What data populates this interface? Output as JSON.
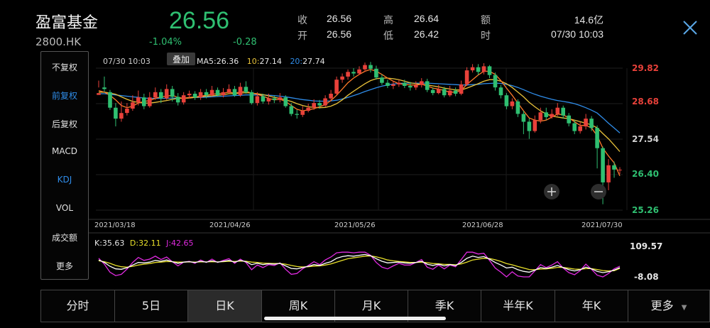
{
  "header": {
    "name": "盈富基金",
    "code": "2800.HK",
    "price": "26.56",
    "change_pct": "-1.04%",
    "change": "-0.28",
    "quote": [
      {
        "label": "收",
        "value": "26.56"
      },
      {
        "label": "开",
        "value": "26.56"
      },
      {
        "label": "高",
        "value": "26.64"
      },
      {
        "label": "低",
        "value": "26.42"
      },
      {
        "label": "额",
        "value": "14.6亿"
      },
      {
        "label": "时",
        "value": "07/30 10:03"
      }
    ],
    "close_icon": "close-icon"
  },
  "sidebar": {
    "items": [
      {
        "label": "不复权",
        "active": false
      },
      {
        "label": "前复权",
        "active": true
      },
      {
        "label": "后复权",
        "active": false
      },
      {
        "label": "MACD",
        "active": false
      },
      {
        "label": "KDJ",
        "active": true
      },
      {
        "label": "VOL",
        "active": false
      },
      {
        "label": "成交额",
        "active": false
      },
      {
        "label": "更多",
        "active": false
      }
    ]
  },
  "chart_info": {
    "time": "07/30 10:03",
    "overlay_label": "叠加",
    "ma5_label": "MA5:",
    "ma5_value": "26.36",
    "ma10_label": "10:",
    "ma10_value": "27.14",
    "ma20_label": "20:",
    "ma20_value": "27.74",
    "price_ticks": [
      "29.82",
      "28.68",
      "27.54",
      "26.40",
      "25.26"
    ],
    "date_ticks": [
      "2021/03/18",
      "2021/04/26",
      "2021/05/26",
      "2021/06/28",
      "2021/07/30"
    ],
    "kdj_k_label": "K:35.63",
    "kdj_d_label": "D:32.11",
    "kdj_j_label": "J:42.65",
    "kdj_max": "109.57",
    "kdj_min": "-8.08",
    "zoom_in_icon": "plus-icon",
    "zoom_out_icon": "minus-icon"
  },
  "colors": {
    "up": "#e8413a",
    "down": "#2fbf71",
    "ma5": "#ff7a2a",
    "ma10": "#e8c23a",
    "ma20": "#2f8ce8",
    "k": "#ffffff",
    "d": "#e8e02a",
    "j": "#e02ae0"
  },
  "chart_data": {
    "type": "candlestick",
    "ylim": [
      25.26,
      29.82
    ],
    "x_labels": [
      "2021/03/18",
      "2021/04/26",
      "2021/05/26",
      "2021/06/28",
      "2021/07/30"
    ],
    "candles": [
      [
        28.96,
        29.02,
        29.42,
        29.2
      ],
      [
        29.2,
        29.15,
        29.55,
        29.05
      ],
      [
        29.05,
        28.55,
        29.12,
        28.48
      ],
      [
        28.55,
        28.2,
        28.7,
        27.95
      ],
      [
        28.2,
        28.38,
        28.75,
        28.1
      ],
      [
        28.38,
        28.52,
        28.7,
        28.3
      ],
      [
        28.52,
        28.72,
        28.95,
        28.45
      ],
      [
        28.72,
        28.88,
        29.1,
        28.62
      ],
      [
        28.88,
        28.6,
        29.0,
        28.5
      ],
      [
        28.6,
        28.88,
        29.05,
        28.55
      ],
      [
        28.88,
        29.05,
        29.2,
        28.8
      ],
      [
        29.05,
        28.85,
        29.15,
        28.7
      ],
      [
        28.85,
        29.15,
        29.3,
        28.8
      ],
      [
        29.15,
        28.9,
        29.25,
        28.75
      ],
      [
        28.9,
        28.72,
        29.02,
        28.62
      ],
      [
        28.72,
        28.95,
        29.05,
        28.65
      ],
      [
        28.95,
        29.0,
        29.1,
        28.85
      ],
      [
        29.0,
        28.88,
        29.08,
        28.8
      ],
      [
        28.88,
        29.05,
        29.15,
        28.8
      ],
      [
        29.05,
        28.95,
        29.15,
        28.85
      ],
      [
        28.95,
        29.12,
        29.25,
        28.9
      ],
      [
        29.12,
        28.95,
        29.2,
        28.9
      ],
      [
        28.95,
        29.05,
        29.18,
        28.88
      ],
      [
        29.05,
        29.15,
        29.3,
        29.0
      ],
      [
        29.15,
        28.95,
        29.25,
        28.9
      ],
      [
        28.95,
        29.22,
        29.35,
        28.9
      ],
      [
        29.22,
        29.05,
        29.4,
        29.0
      ],
      [
        29.05,
        28.7,
        29.12,
        28.65
      ],
      [
        28.7,
        28.92,
        29.05,
        28.62
      ],
      [
        28.92,
        28.75,
        29.0,
        28.68
      ],
      [
        28.75,
        28.85,
        29.0,
        28.65
      ],
      [
        28.85,
        28.8,
        28.95,
        28.7
      ],
      [
        28.8,
        28.88,
        29.02,
        28.72
      ],
      [
        28.88,
        28.6,
        28.95,
        28.55
      ],
      [
        28.6,
        28.35,
        28.7,
        28.28
      ],
      [
        28.35,
        28.32,
        28.48,
        28.2
      ],
      [
        28.32,
        28.45,
        28.6,
        28.25
      ],
      [
        28.45,
        28.55,
        28.68,
        28.4
      ],
      [
        28.55,
        28.7,
        28.82,
        28.48
      ],
      [
        28.7,
        28.62,
        28.8,
        28.52
      ],
      [
        28.62,
        28.85,
        28.95,
        28.58
      ],
      [
        28.85,
        29.0,
        29.12,
        28.8
      ],
      [
        29.0,
        29.45,
        29.55,
        28.95
      ],
      [
        29.45,
        29.55,
        29.65,
        29.35
      ],
      [
        29.55,
        29.7,
        29.78,
        29.45
      ],
      [
        29.7,
        29.65,
        29.82,
        29.55
      ],
      [
        29.65,
        29.78,
        29.88,
        29.6
      ],
      [
        29.78,
        29.92,
        30.0,
        29.7
      ],
      [
        29.92,
        29.8,
        30.02,
        29.68
      ],
      [
        29.8,
        29.52,
        29.9,
        29.45
      ],
      [
        29.52,
        29.35,
        29.62,
        29.28
      ],
      [
        29.35,
        29.25,
        29.45,
        29.18
      ],
      [
        29.25,
        29.3,
        29.42,
        29.15
      ],
      [
        29.3,
        29.35,
        29.45,
        29.22
      ],
      [
        29.35,
        29.25,
        29.45,
        29.18
      ],
      [
        29.25,
        29.2,
        29.38,
        29.1
      ],
      [
        29.2,
        29.28,
        29.4,
        29.12
      ],
      [
        29.28,
        29.4,
        29.5,
        29.2
      ],
      [
        29.4,
        29.12,
        29.48,
        29.05
      ],
      [
        29.12,
        29.02,
        29.2,
        28.95
      ],
      [
        29.02,
        29.15,
        29.28,
        28.98
      ],
      [
        29.15,
        28.95,
        29.22,
        28.88
      ],
      [
        28.95,
        29.1,
        29.25,
        28.9
      ],
      [
        29.1,
        29.0,
        29.2,
        28.92
      ],
      [
        29.0,
        29.3,
        29.42,
        28.95
      ],
      [
        29.3,
        29.75,
        29.85,
        29.25
      ],
      [
        29.75,
        29.85,
        29.95,
        29.68
      ],
      [
        29.85,
        29.7,
        29.95,
        29.6
      ],
      [
        29.7,
        29.88,
        29.98,
        29.62
      ],
      [
        29.88,
        29.6,
        29.92,
        29.5
      ],
      [
        29.6,
        29.2,
        29.68,
        29.1
      ],
      [
        29.2,
        28.95,
        29.28,
        28.85
      ],
      [
        28.95,
        28.6,
        29.02,
        28.5
      ],
      [
        28.6,
        28.75,
        28.85,
        28.5
      ],
      [
        28.75,
        28.35,
        28.82,
        28.25
      ],
      [
        28.35,
        28.1,
        28.45,
        27.7
      ],
      [
        28.1,
        27.8,
        28.2,
        27.55
      ],
      [
        27.8,
        28.15,
        28.3,
        27.75
      ],
      [
        28.15,
        28.4,
        28.55,
        28.05
      ],
      [
        28.4,
        28.25,
        28.55,
        28.15
      ],
      [
        28.25,
        28.35,
        28.5,
        28.2
      ],
      [
        28.35,
        28.55,
        28.7,
        28.28
      ],
      [
        28.55,
        28.3,
        28.62,
        28.2
      ],
      [
        28.3,
        28.05,
        28.38,
        27.95
      ],
      [
        28.05,
        27.8,
        28.15,
        27.7
      ],
      [
        27.8,
        27.95,
        28.1,
        27.72
      ],
      [
        27.95,
        28.2,
        28.35,
        27.85
      ],
      [
        28.2,
        27.9,
        28.28,
        27.8
      ],
      [
        27.9,
        27.25,
        27.98,
        26.6
      ],
      [
        27.25,
        26.15,
        27.3,
        25.45
      ],
      [
        26.15,
        26.7,
        26.9,
        25.9
      ],
      [
        26.7,
        26.56,
        26.82,
        26.3
      ],
      [
        26.56,
        26.56,
        26.64,
        26.42
      ]
    ],
    "ma5": [
      29.1,
      29.05,
      28.95,
      28.8,
      28.62,
      28.55,
      28.6,
      28.7,
      28.75,
      28.78,
      28.85,
      28.9,
      28.92,
      28.95,
      28.88,
      28.85,
      28.88,
      28.9,
      28.92,
      28.95,
      28.98,
      29.0,
      29.02,
      29.05,
      29.02,
      29.05,
      29.08,
      29.02,
      28.98,
      28.92,
      28.85,
      28.8,
      28.82,
      28.75,
      28.62,
      28.5,
      28.45,
      28.48,
      28.52,
      28.58,
      28.65,
      28.78,
      28.95,
      29.15,
      29.35,
      29.5,
      29.62,
      29.72,
      29.78,
      29.72,
      29.62,
      29.5,
      29.4,
      29.32,
      29.3,
      29.28,
      29.28,
      29.3,
      29.25,
      29.18,
      29.15,
      29.1,
      29.05,
      29.05,
      29.1,
      29.3,
      29.45,
      29.6,
      29.72,
      29.72,
      29.62,
      29.42,
      29.18,
      28.95,
      28.7,
      28.45,
      28.22,
      28.15,
      28.12,
      28.15,
      28.25,
      28.35,
      28.32,
      28.22,
      28.1,
      27.98,
      27.98,
      27.9,
      27.65,
      27.25,
      27.0,
      26.78,
      26.36
    ],
    "ma10": [
      29.05,
      29.05,
      29.02,
      28.98,
      28.9,
      28.82,
      28.75,
      28.72,
      28.7,
      28.7,
      28.72,
      28.75,
      28.78,
      28.82,
      28.85,
      28.85,
      28.86,
      28.88,
      28.9,
      28.92,
      28.93,
      28.95,
      28.97,
      29.0,
      29.0,
      29.02,
      29.03,
      29.02,
      29.0,
      28.97,
      28.93,
      28.88,
      28.85,
      28.8,
      28.75,
      28.68,
      28.62,
      28.58,
      28.56,
      28.55,
      28.56,
      28.6,
      28.68,
      28.8,
      28.95,
      29.08,
      29.2,
      29.32,
      29.42,
      29.48,
      29.5,
      29.5,
      29.48,
      29.45,
      29.4,
      29.35,
      29.32,
      29.3,
      29.28,
      29.25,
      29.22,
      29.18,
      29.15,
      29.12,
      29.12,
      29.18,
      29.25,
      29.32,
      29.4,
      29.45,
      29.45,
      29.4,
      29.32,
      29.2,
      29.05,
      28.9,
      28.72,
      28.58,
      28.45,
      28.35,
      28.28,
      28.25,
      28.22,
      28.2,
      28.15,
      28.1,
      28.05,
      28.0,
      27.9,
      27.72,
      27.55,
      27.35,
      27.14
    ],
    "ma20": [
      29.0,
      29.0,
      28.98,
      28.96,
      28.94,
      28.92,
      28.9,
      28.88,
      28.86,
      28.85,
      28.85,
      28.85,
      28.85,
      28.86,
      28.86,
      28.86,
      28.87,
      28.88,
      28.88,
      28.89,
      28.9,
      28.91,
      28.92,
      28.93,
      28.94,
      28.95,
      28.96,
      28.96,
      28.96,
      28.96,
      28.95,
      28.94,
      28.92,
      28.9,
      28.87,
      28.84,
      28.81,
      28.79,
      28.77,
      28.76,
      28.76,
      28.77,
      28.79,
      28.83,
      28.88,
      28.94,
      29.0,
      29.07,
      29.13,
      29.19,
      29.24,
      29.28,
      29.31,
      29.33,
      29.34,
      29.34,
      29.34,
      29.34,
      29.34,
      29.33,
      29.32,
      29.31,
      29.3,
      29.29,
      29.28,
      29.28,
      29.29,
      29.3,
      29.32,
      29.33,
      29.34,
      29.33,
      29.3,
      29.26,
      29.2,
      29.13,
      29.05,
      28.98,
      28.92,
      28.87,
      28.82,
      28.78,
      28.75,
      28.72,
      28.68,
      28.62,
      28.55,
      28.47,
      28.38,
      28.22,
      28.05,
      27.9,
      27.74
    ],
    "kdj": {
      "ylim": [
        -8.08,
        109.57
      ],
      "k": [
        72,
        60,
        42,
        30,
        28,
        35,
        48,
        60,
        58,
        62,
        70,
        66,
        72,
        64,
        56,
        62,
        64,
        60,
        66,
        62,
        68,
        62,
        66,
        70,
        62,
        70,
        64,
        50,
        56,
        50,
        54,
        52,
        56,
        44,
        32,
        30,
        36,
        42,
        50,
        46,
        56,
        64,
        80,
        88,
        92,
        90,
        94,
        98,
        92,
        78,
        66,
        58,
        60,
        62,
        58,
        56,
        60,
        66,
        52,
        46,
        52,
        44,
        50,
        46,
        60,
        80,
        90,
        84,
        88,
        76,
        60,
        48,
        34,
        38,
        26,
        18,
        14,
        24,
        36,
        32,
        38,
        46,
        36,
        26,
        20,
        26,
        38,
        30,
        18,
        12,
        16,
        24,
        35.63
      ],
      "d": [
        68,
        64,
        56,
        46,
        40,
        38,
        42,
        48,
        52,
        55,
        60,
        62,
        65,
        64,
        62,
        62,
        63,
        62,
        63,
        63,
        64,
        63,
        64,
        66,
        65,
        67,
        66,
        62,
        60,
        57,
        56,
        55,
        55,
        52,
        46,
        41,
        39,
        40,
        43,
        44,
        48,
        53,
        62,
        70,
        78,
        82,
        86,
        90,
        91,
        87,
        80,
        72,
        68,
        65,
        63,
        60,
        60,
        62,
        59,
        55,
        54,
        51,
        51,
        49,
        53,
        62,
        72,
        76,
        80,
        79,
        73,
        65,
        55,
        49,
        41,
        34,
        27,
        26,
        29,
        30,
        33,
        37,
        37,
        33,
        29,
        28,
        31,
        31,
        27,
        22,
        20,
        21,
        32.11
      ],
      "j": [
        80,
        52,
        14,
        -2,
        4,
        29,
        60,
        84,
        70,
        76,
        90,
        74,
        86,
        64,
        44,
        62,
        66,
        56,
        72,
        60,
        76,
        60,
        70,
        78,
        56,
        76,
        60,
        26,
        48,
        36,
        50,
        46,
        58,
        28,
        4,
        8,
        30,
        46,
        64,
        50,
        72,
        86,
        106,
        109,
        109,
        106,
        109,
        109,
        94,
        60,
        38,
        30,
        44,
        56,
        48,
        48,
        60,
        74,
        38,
        28,
        48,
        30,
        48,
        40,
        74,
        109,
        109,
        100,
        104,
        70,
        34,
        14,
        -8,
        16,
        -4,
        -8,
        -8,
        20,
        50,
        36,
        48,
        64,
        34,
        12,
        2,
        22,
        52,
        28,
        0,
        -8,
        8,
        30,
        42.65
      ]
    }
  }
}
